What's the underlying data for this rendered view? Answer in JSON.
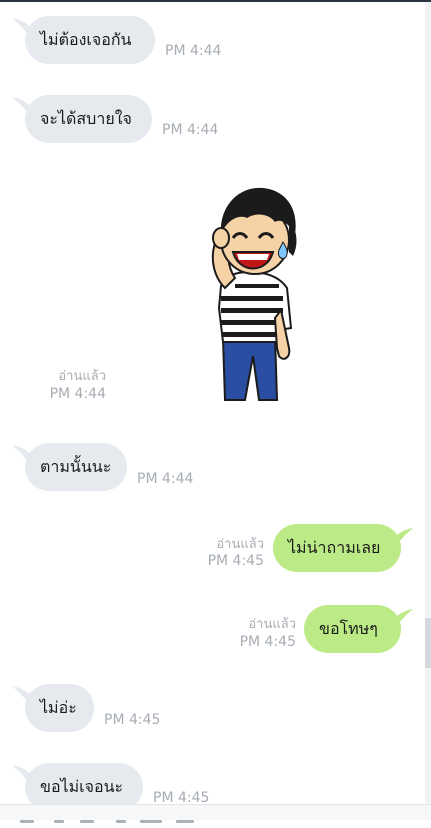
{
  "messages": [
    {
      "text": "ไม่ต้องเจอกัน",
      "time": "PM 4:44"
    },
    {
      "text": "จะได้สบายใจ",
      "time": "PM 4:44"
    },
    {
      "sticker": "laughing-boy-sticker",
      "read": "อ่านแล้ว",
      "time": "PM 4:44"
    },
    {
      "text": "ตามนั้นนะ",
      "time": "PM 4:44"
    },
    {
      "text": "ไม่น่าถามเลย",
      "read": "อ่านแล้ว",
      "time": "PM 4:45"
    },
    {
      "text": "ขอโทษๆ",
      "read": "อ่านแล้ว",
      "time": "PM 4:45"
    },
    {
      "text": "ไม่อ่ะ",
      "time": "PM 4:45"
    },
    {
      "text": "ขอไม่เจอนะ",
      "time": "PM 4:45"
    }
  ],
  "colors": {
    "incoming_bubble": "#e6e9ed",
    "outgoing_bubble": "#bbea86",
    "meta_text": "#a7adb4"
  }
}
